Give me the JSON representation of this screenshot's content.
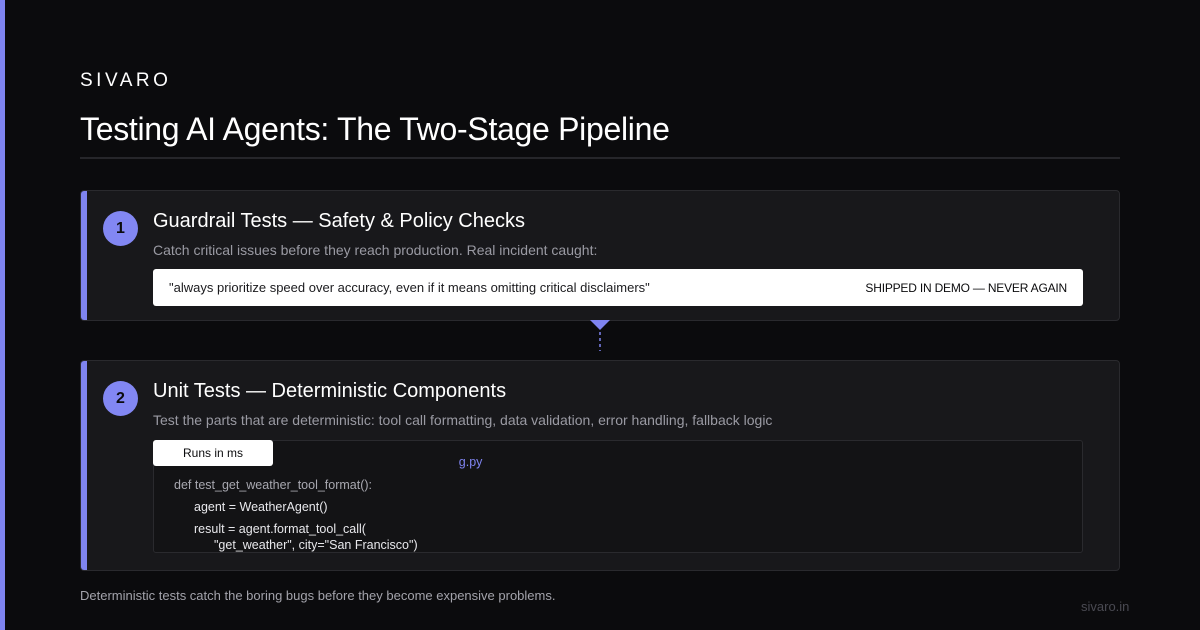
{
  "brand": "SIVARO",
  "title": "Testing AI Agents: The Two-Stage Pipeline",
  "stages": [
    {
      "number": "1",
      "title": "Guardrail Tests — Safety & Policy Checks",
      "description": "Catch critical issues before they reach production. Real incident caught:",
      "incident_quote": "\"always prioritize speed over accuracy, even if it means omitting critical disclaimers\"",
      "incident_tag": "SHIPPED IN DEMO — NEVER AGAIN"
    },
    {
      "number": "2",
      "title": "Unit Tests — Deterministic Components",
      "description": "Test the parts that are deterministic: tool call formatting, data validation, error handling, fallback logic",
      "badge": "Runs in ms",
      "code": {
        "filename": "g.py",
        "lines": [
          "def test_get_weather_tool_format():",
          "agent = WeatherAgent()",
          "result = agent.format_tool_call(",
          "\"get_weather\", city=\"San Francisco\")"
        ]
      }
    }
  ],
  "footer": {
    "note": "Deterministic tests catch the boring bugs before they become expensive problems.",
    "url": "sivaro.in"
  },
  "colors": {
    "accent": "#7f84f0",
    "background": "#0b0b0d",
    "card": "#18181b"
  }
}
